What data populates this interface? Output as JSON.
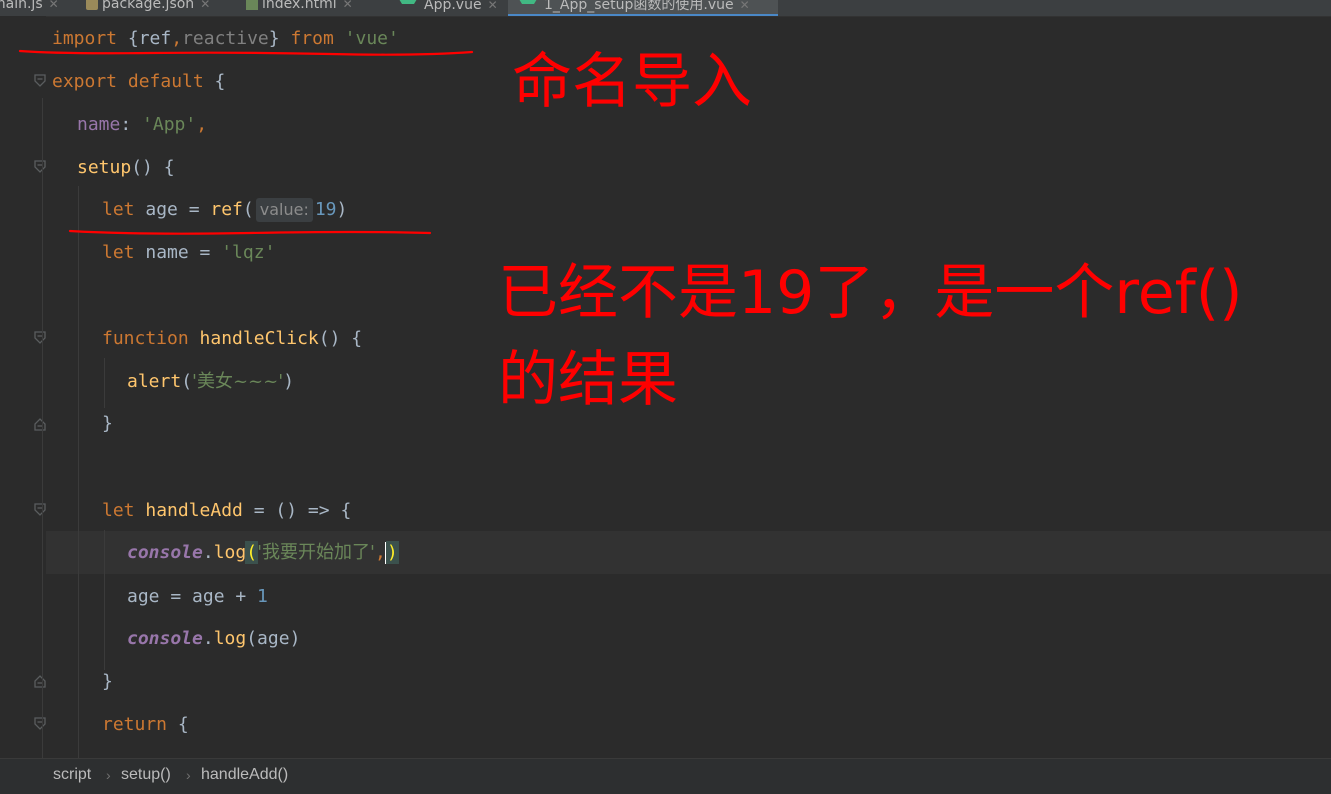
{
  "tabs": [
    {
      "label": "main.js",
      "icon": "js-file-icon"
    },
    {
      "label": "package.json",
      "icon": "json-file-icon"
    },
    {
      "label": "index.html",
      "icon": "html-file-icon"
    },
    {
      "label": "App.vue",
      "icon": "vue-file-icon"
    },
    {
      "label": "1_App_setup函数的使用.vue",
      "icon": "vue-file-icon",
      "active": true
    }
  ],
  "code": {
    "l1": {
      "kw1": "import",
      "brace_open": " {",
      "ref": "ref",
      "comma": ",",
      "reactive": "reactive",
      "brace_close": "} ",
      "from": "from",
      "sp": " ",
      "module": "'vue'"
    },
    "l2": {
      "kw": "export default",
      "rest": " {"
    },
    "l3": {
      "prop": "name",
      "colon": ": ",
      "value": "'App'",
      "comma": ","
    },
    "l4": {
      "fn": "setup",
      "rest": "() {"
    },
    "l5": {
      "kw": "let",
      "name": " age = ",
      "fn": "ref",
      "paren": "(",
      "hint": "value:",
      "num": "19",
      "close": ")"
    },
    "l6": {
      "kw": "let",
      "name": " name = ",
      "value": "'lqz'"
    },
    "l7": {
      "kw": "function",
      "sp": " ",
      "fn": "handleClick",
      "rest": "() {"
    },
    "l8": {
      "fn": "alert",
      "open": "(",
      "value": "'美女~~~'",
      "close": ")"
    },
    "l9": {
      "rest": "}"
    },
    "l10": {
      "kw": "let",
      "sp": " ",
      "fn": "handleAdd",
      "rest": " = () => {"
    },
    "l11": {
      "obj": "console",
      "dot": ".",
      "fn": "log",
      "open": "(",
      "value": "'我要开始加了'",
      "comma": ",",
      "close": ")"
    },
    "l12": {
      "text": "age = age + ",
      "num": "1"
    },
    "l13": {
      "obj": "console",
      "dot": ".",
      "fn": "log",
      "rest": "(age)"
    },
    "l14": {
      "rest": "}"
    },
    "l15": {
      "kw": "return",
      "rest": " {"
    }
  },
  "annotations": {
    "named_import": "命名导入",
    "not_19_line1": "已经不是19了，是一个ref()",
    "not_19_line2": "的结果",
    "color": "#ff0000"
  },
  "breadcrumb": [
    "script",
    "setup()",
    "handleAdd()"
  ],
  "colors": {
    "background": "#2b2b2b",
    "keyword": "#cc7832",
    "string": "#6a8759",
    "number": "#6897bb",
    "property": "#9876aa",
    "function": "#ffc66d",
    "annotation": "#ff0000"
  }
}
